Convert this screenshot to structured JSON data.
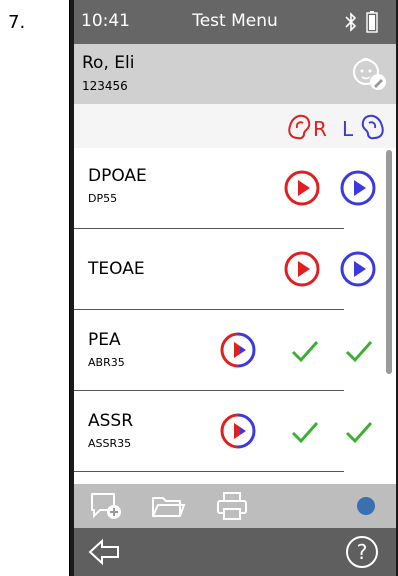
{
  "figure": {
    "step_number": "7."
  },
  "statusbar": {
    "time": "10:41",
    "title": "Test Menu",
    "bluetooth_icon": "bluetooth-icon",
    "battery_icon": "battery-icon"
  },
  "patient": {
    "name": "Ro, Eli",
    "id": "123456",
    "icon": "baby-edit-icon"
  },
  "ears": {
    "right_label": "R",
    "left_label": "L",
    "right_color": "#e02020",
    "left_color": "#3a3ae0"
  },
  "tests": [
    {
      "label": "DPOAE",
      "protocol": "DP55",
      "right": "play",
      "left": "play"
    },
    {
      "label": "TEOAE",
      "protocol": "",
      "right": "play",
      "left": "play"
    },
    {
      "label": "PEA",
      "protocol": "ABR35",
      "binaural": "play",
      "right": "done",
      "left": "done"
    },
    {
      "label": "ASSR",
      "protocol": "ASSR35",
      "binaural": "play",
      "right": "done",
      "left": "done"
    }
  ],
  "toolbar": {
    "icons": [
      "add-comment-icon",
      "folder-icon",
      "printer-icon"
    ],
    "status_dot_color": "#3a6fb0"
  },
  "navbar": {
    "back_icon": "back-arrow-icon",
    "help_icon": "help-icon",
    "help_glyph": "?"
  },
  "colors": {
    "red": "#e02020",
    "blue": "#3a3ae0",
    "green": "#3cb034",
    "statusbar_bg": "#666666"
  }
}
